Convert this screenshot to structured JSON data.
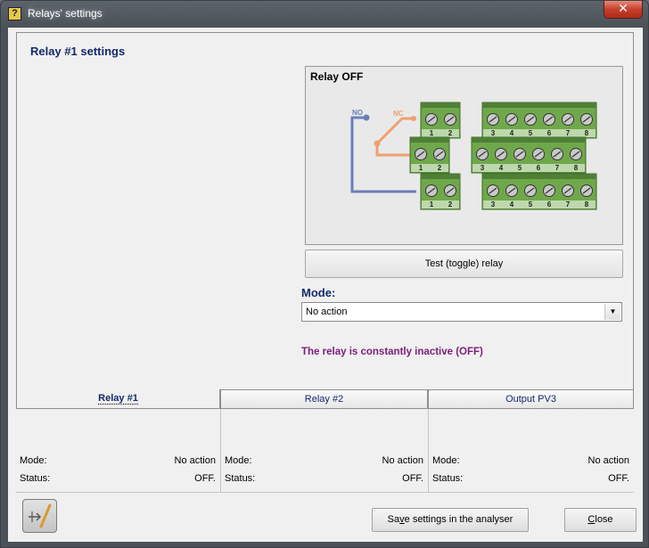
{
  "window": {
    "title": "Relays' settings",
    "close_glyph": "✕",
    "app_icon": "question-mark-icon"
  },
  "settings": {
    "title": "Relay #1 settings",
    "relay_state": "Relay OFF",
    "diagram": {
      "no_label": "NO",
      "nc_label": "NC",
      "left_terminals": [
        "1",
        "2"
      ],
      "right_terminals": [
        "3",
        "4",
        "5",
        "6",
        "7",
        "8"
      ]
    },
    "test_button": "Test (toggle) relay",
    "mode_label": "Mode:",
    "mode_value": "No action",
    "status_message": "The relay is constantly inactive (OFF)"
  },
  "tabs": [
    {
      "label": "Relay #1",
      "active": true
    },
    {
      "label": "Relay #2",
      "active": false
    },
    {
      "label": "Output PV3",
      "active": false
    }
  ],
  "summary": [
    {
      "mode_label": "Mode:",
      "mode_value": "No action",
      "status_label": "Status:",
      "status_value": "OFF."
    },
    {
      "mode_label": "Mode:",
      "mode_value": "No action",
      "status_label": "Status:",
      "status_value": "OFF."
    },
    {
      "mode_label": "Mode:",
      "mode_value": "No action",
      "status_label": "Status:",
      "status_value": "OFF."
    }
  ],
  "footer": {
    "save_button": {
      "before": "Sa",
      "key": "v",
      "after": "e settings in the analyser"
    },
    "close_button": {
      "key": "C",
      "after": "lose"
    },
    "tool_icon": "relay-switch-icon"
  },
  "colors": {
    "heading": "#142a6b",
    "status_message": "#7a1e7a",
    "terminal_green": "#6fa84a",
    "no_wire": "#6a7fb8",
    "nc_wire": "#f0a070"
  }
}
